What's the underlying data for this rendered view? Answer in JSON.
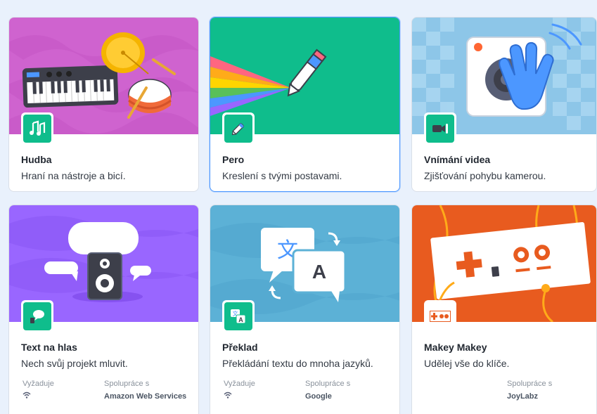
{
  "extensions": [
    {
      "title": "Hudba",
      "description": "Hraní na nástroje a bicí.",
      "icon": "music-notes-icon"
    },
    {
      "title": "Pero",
      "description": "Kreslení s tvými postavami.",
      "icon": "pen-icon"
    },
    {
      "title": "Vnímání videa",
      "description": "Zjišťování pohybu kamerou.",
      "icon": "video-camera-icon"
    },
    {
      "title": "Text na hlas",
      "description": "Nech svůj projekt mluvit.",
      "icon": "speech-bubble-icon",
      "requires_label": "Vyžaduje",
      "collab_label": "Spolupráce s",
      "collaborator": "Amazon Web Services"
    },
    {
      "title": "Překlad",
      "description": "Překládání textu do mnoha jazyků.",
      "icon": "translate-icon",
      "requires_label": "Vyžaduje",
      "collab_label": "Spolupráce s",
      "collaborator": "Google"
    },
    {
      "title": "Makey Makey",
      "description": "Udělej vše do klíče.",
      "icon": "makey-makey-icon",
      "collab_label": "Spolupráce s",
      "collaborator": "JoyLabz"
    }
  ],
  "colors": {
    "background": "#e9f1fc",
    "icon_tile": "#0fbd8c",
    "selected_border": "#4c97ff"
  }
}
